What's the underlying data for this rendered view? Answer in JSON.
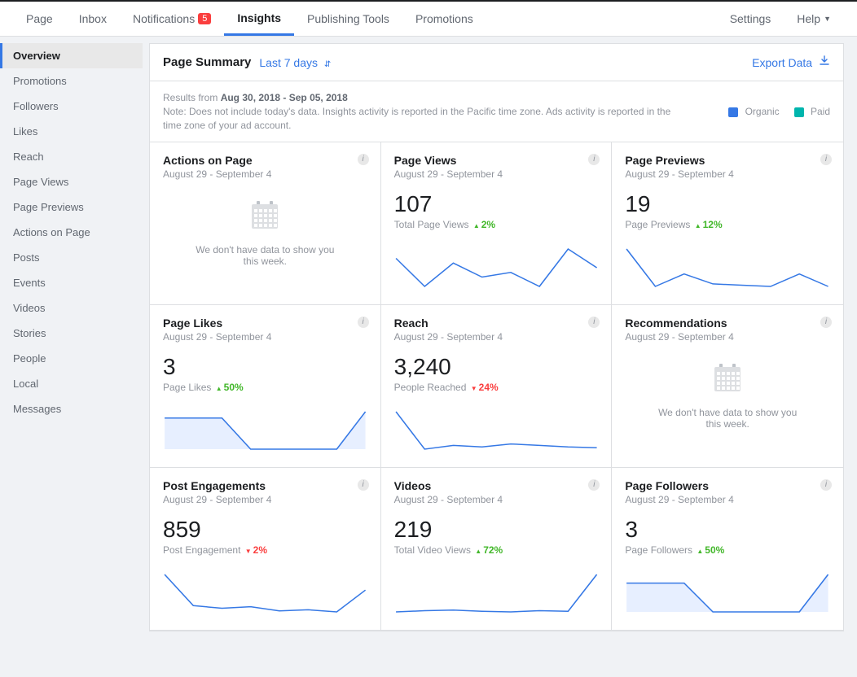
{
  "nav": {
    "items": [
      "Page",
      "Inbox",
      "Notifications",
      "Insights",
      "Publishing Tools",
      "Promotions"
    ],
    "badge_count": "5",
    "active": "Insights",
    "settings": "Settings",
    "help": "Help"
  },
  "sidebar": {
    "items": [
      "Overview",
      "Promotions",
      "Followers",
      "Likes",
      "Reach",
      "Page Views",
      "Page Previews",
      "Actions on Page",
      "Posts",
      "Events",
      "Videos",
      "Stories",
      "People",
      "Local",
      "Messages"
    ],
    "active": "Overview"
  },
  "summary": {
    "title": "Page Summary",
    "range": "Last 7 days",
    "export": "Export Data",
    "results_prefix": "Results from ",
    "results_dates": "Aug 30, 2018 - Sep 05, 2018",
    "note": "Note: Does not include today's data. Insights activity is reported in the Pacific time zone. Ads activity is reported in the time zone of your ad account."
  },
  "legend": {
    "organic": {
      "label": "Organic",
      "color": "#3578e5"
    },
    "paid": {
      "label": "Paid",
      "color": "#00b5ad"
    }
  },
  "no_data_text": "We don't have data to show you this week.",
  "cards": {
    "actions": {
      "title": "Actions on Page",
      "date": "August 29 - September 4",
      "metric": "",
      "sublabel": "",
      "delta": "",
      "no_data": true
    },
    "views": {
      "title": "Page Views",
      "date": "August 29 - September 4",
      "metric": "107",
      "sublabel": "Total Page Views",
      "delta": "2%",
      "delta_dir": "up"
    },
    "previews": {
      "title": "Page Previews",
      "date": "August 29 - September 4",
      "metric": "19",
      "sublabel": "Page Previews",
      "delta": "12%",
      "delta_dir": "up"
    },
    "likes": {
      "title": "Page Likes",
      "date": "August 29 - September 4",
      "metric": "3",
      "sublabel": "Page Likes",
      "delta": "50%",
      "delta_dir": "up"
    },
    "reach": {
      "title": "Reach",
      "date": "August 29 - September 4",
      "metric": "3,240",
      "sublabel": "People Reached",
      "delta": "24%",
      "delta_dir": "down"
    },
    "recs": {
      "title": "Recommendations",
      "date": "August 29 - September 4",
      "metric": "",
      "sublabel": "",
      "delta": "",
      "no_data": true
    },
    "engagements": {
      "title": "Post Engagements",
      "date": "August 29 - September 4",
      "metric": "859",
      "sublabel": "Post Engagement",
      "delta": "2%",
      "delta_dir": "down"
    },
    "videos": {
      "title": "Videos",
      "date": "August 29 - September 4",
      "metric": "219",
      "sublabel": "Total Video Views",
      "delta": "72%",
      "delta_dir": "up"
    },
    "followers": {
      "title": "Page Followers",
      "date": "August 29 - September 4",
      "metric": "3",
      "sublabel": "Page Followers",
      "delta": "50%",
      "delta_dir": "up"
    }
  },
  "chart_data": [
    {
      "id": "views",
      "type": "line",
      "y": [
        18,
        12,
        17,
        14,
        15,
        12,
        20,
        16
      ]
    },
    {
      "id": "previews",
      "type": "line",
      "y": [
        5,
        2,
        3,
        2.2,
        2.1,
        2,
        3,
        2
      ]
    },
    {
      "id": "likes",
      "type": "area",
      "y": [
        1,
        1,
        1,
        0,
        0,
        0,
        0,
        1.2
      ]
    },
    {
      "id": "reach",
      "type": "line",
      "y": [
        900,
        400,
        450,
        430,
        470,
        450,
        430,
        420
      ]
    },
    {
      "id": "engagements",
      "type": "line",
      "y": [
        180,
        120,
        115,
        118,
        110,
        112,
        108,
        150
      ]
    },
    {
      "id": "videos",
      "type": "line",
      "y": [
        20,
        22,
        23,
        21,
        20,
        22,
        21,
        80
      ]
    },
    {
      "id": "followers",
      "type": "area",
      "y": [
        1,
        1,
        1,
        0,
        0,
        0,
        0,
        1.3
      ]
    }
  ]
}
